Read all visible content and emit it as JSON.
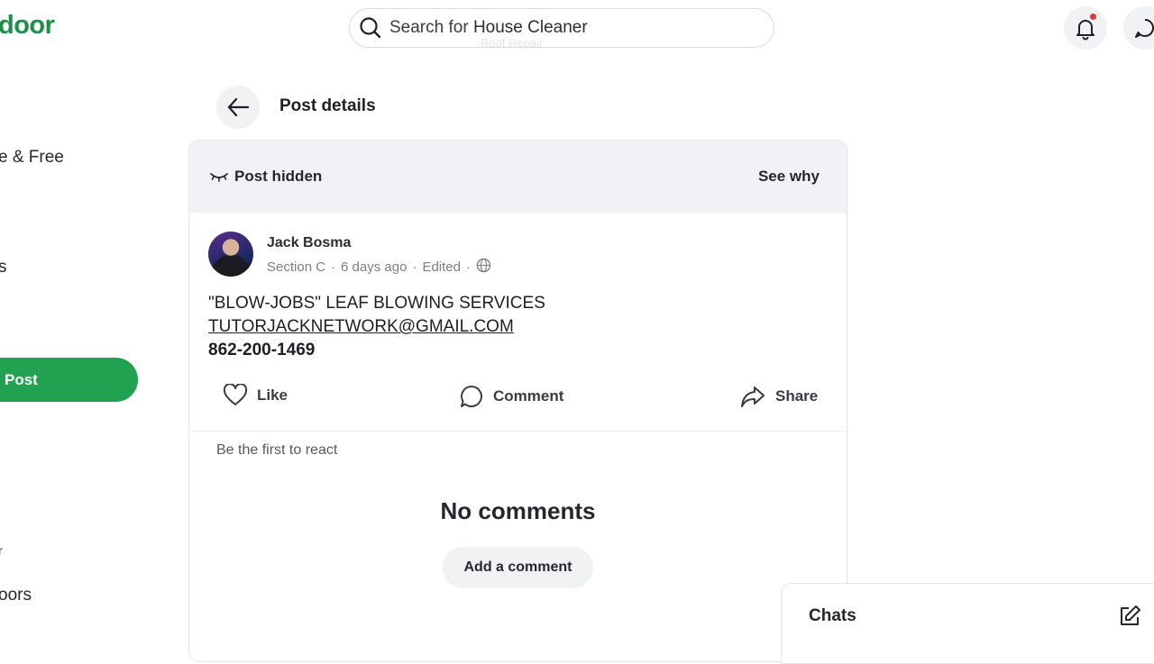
{
  "header": {
    "logo_text": "door",
    "search_prefix": "Search for",
    "search_term": "House Cleaner",
    "search_ghost": "Roof Repair"
  },
  "sidebar": {
    "items": [
      {
        "label": "e & Free"
      },
      {
        "label": "s"
      },
      {
        "label": "r"
      },
      {
        "label": "oors"
      }
    ],
    "post_button": "Post"
  },
  "page": {
    "title": "Post details"
  },
  "post": {
    "hidden_label": "Post hidden",
    "see_why": "See why",
    "author": "Jack Bosma",
    "section": "Section C",
    "time_ago": "6 days ago",
    "edited": "Edited",
    "lines": {
      "headline": "\"BLOW-JOBS\" LEAF BLOWING SERVICES",
      "email": "TUTORJACKNETWORK@GMAIL.COM",
      "phone": "862-200-1469"
    },
    "actions": {
      "like": "Like",
      "comment": "Comment",
      "share": "Share"
    },
    "first_react": "Be the first to react",
    "no_comments": "No comments",
    "add_comment": "Add a comment"
  },
  "chats": {
    "title": "Chats"
  },
  "colors": {
    "brand_green": "#22a150",
    "notification": "#e53935"
  }
}
